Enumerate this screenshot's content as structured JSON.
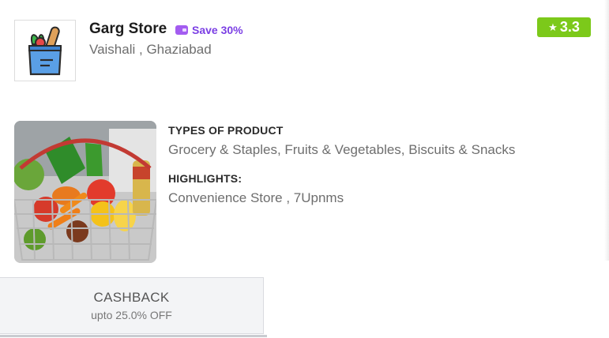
{
  "store": {
    "name": "Garg Store",
    "save_badge": "Save 30%",
    "location": "Vaishali , Ghaziabad",
    "rating": "3.3",
    "logo_icon": "grocery-bag-icon",
    "save_icon": "wallet-icon",
    "rating_icon": "star-icon"
  },
  "details": {
    "types_label": "TYPES OF PRODUCT",
    "types_value": "Grocery & Staples, Fruits & Vegetables, Biscuits & Snacks",
    "highlights_label": "HIGHLIGHTS:",
    "highlights_value": "Convenience Store , 7Upnms"
  },
  "cashback": {
    "title": "CASHBACK",
    "subtitle": "upto 25.0% OFF"
  },
  "colors": {
    "rating_bg": "#7cc91a",
    "save_badge": "#7b3fe4",
    "cashback_bg": "#f3f4f6"
  }
}
